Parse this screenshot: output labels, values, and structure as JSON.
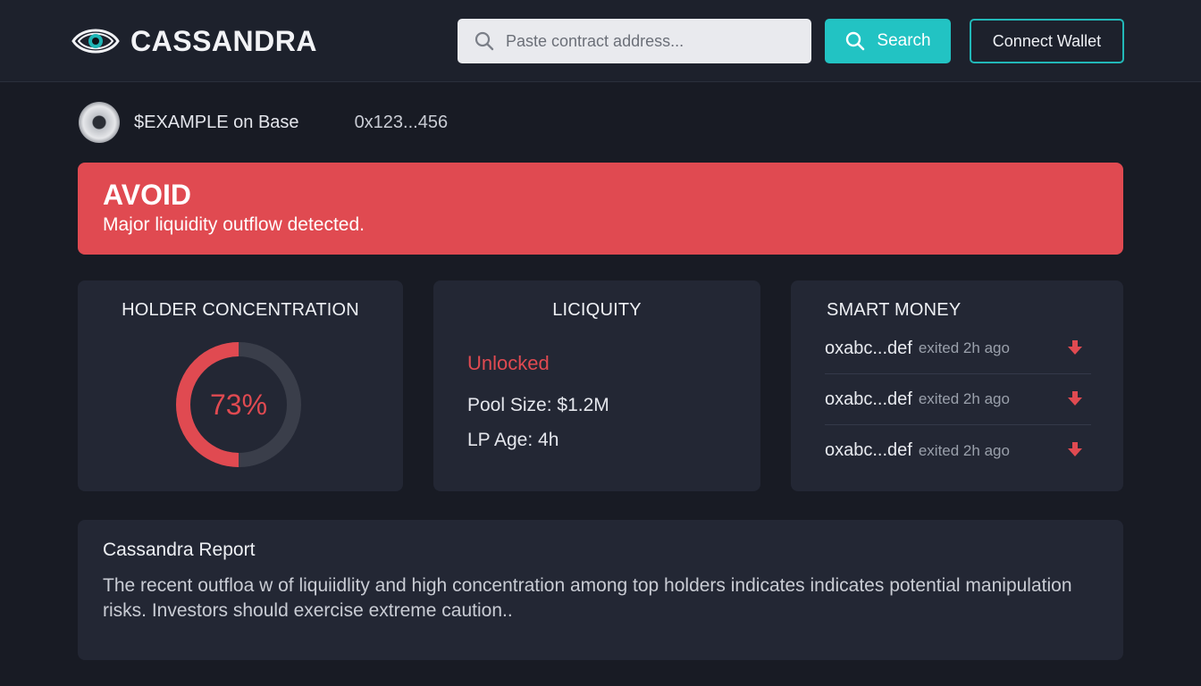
{
  "header": {
    "brand": "CASSANDRA",
    "logo_icon": "eye-icon",
    "search": {
      "placeholder": "Paste contract address...",
      "value": "",
      "icon": "search-icon"
    },
    "search_button_label": "Search",
    "connect_button_label": "Connect Wallet"
  },
  "token": {
    "name": "$EXAMPLE on Base",
    "address": "0x123...456"
  },
  "alert": {
    "title": "AVOID",
    "message": "Major liquidity outflow detected.",
    "color": "#e04a51"
  },
  "holder_concentration": {
    "title": "HOLDER CONCENTRATION",
    "value_label": "73%",
    "fraction": 0.5,
    "color": "#e04a51"
  },
  "liquidity": {
    "title": "LICIQUITY",
    "status": "Unlocked",
    "pool_size": "Pool Size: $1.2M",
    "lp_age": "LP Age: 4h"
  },
  "smart_money": {
    "title": "SMART MONEY",
    "items": [
      {
        "address": "oxabc...def",
        "activity": "exited 2h ago",
        "icon": "arrow-down-icon"
      },
      {
        "address": "oxabc...def",
        "activity": "exited 2h ago",
        "icon": "arrow-down-icon"
      },
      {
        "address": "oxabc...def",
        "activity": "exited 2h ago",
        "icon": "arrow-down-icon"
      }
    ]
  },
  "report": {
    "title": "Cassandra Report",
    "body": "The recent outfloa w of liquiidlity and high concentration among top holders indicates indicates potential manipulation risks. Investors should exercise extreme caution.."
  },
  "colors": {
    "accent": "#22c3c3",
    "danger": "#e04a51",
    "background": "#181b24",
    "card": "#232734"
  }
}
